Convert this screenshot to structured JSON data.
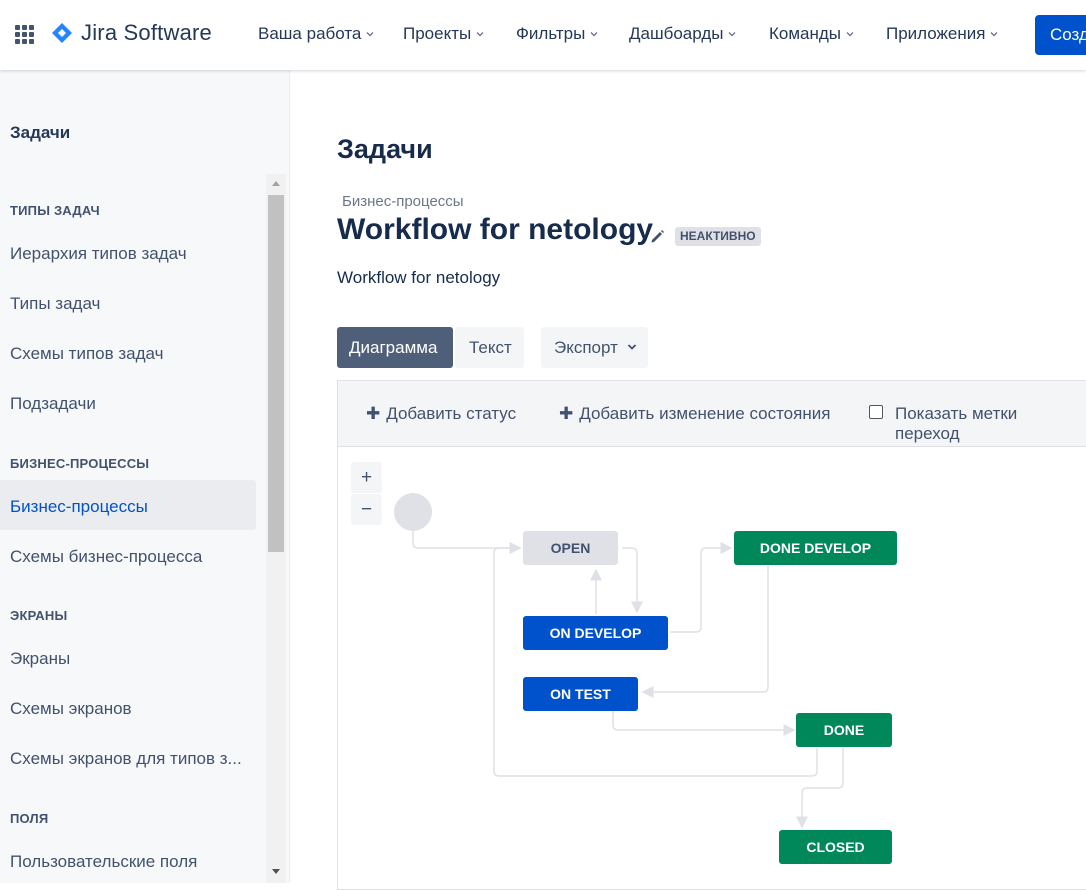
{
  "topbar": {
    "brand": "Jira Software",
    "nav": [
      "Ваша работа",
      "Проекты",
      "Фильтры",
      "Дашбоарды",
      "Команды",
      "Приложения"
    ],
    "create_label": "Созд"
  },
  "sidebar": {
    "title": "Задачи",
    "sections": [
      {
        "heading": "ТИПЫ ЗАДАЧ",
        "items": [
          "Иерархия типов задач",
          "Типы задач",
          "Схемы типов задач",
          "Подзадачи"
        ]
      },
      {
        "heading": "БИЗНЕС-ПРОЦЕССЫ",
        "items": [
          "Бизнес-процессы",
          "Схемы бизнес-процесса"
        ]
      },
      {
        "heading": "ЭКРАНЫ",
        "items": [
          "Экраны",
          "Схемы экранов",
          "Схемы экранов для типов з..."
        ]
      },
      {
        "heading": "ПОЛЯ",
        "items": [
          "Пользовательские поля"
        ]
      }
    ],
    "active_item": "Бизнес-процессы"
  },
  "main": {
    "page_title": "Задачи",
    "breadcrumb": "Бизнес-процессы",
    "workflow_name": "Workflow for netology",
    "status_badge": "НЕАКТИВНО",
    "description": "Workflow for netology",
    "tabs": {
      "diagram": "Диаграмма",
      "text": "Текст",
      "export": "Экспорт"
    },
    "toolbar": {
      "add_status": "Добавить статус",
      "add_transition": "Добавить изменение состояния",
      "show_labels": "Показать метки переход"
    },
    "zoom": {
      "in": "+",
      "out": "−"
    }
  },
  "diagram": {
    "statuses": {
      "open": "OPEN",
      "done_develop": "DONE DEVELOP",
      "on_develop": "ON DEVELOP",
      "on_test": "ON TEST",
      "done": "DONE",
      "closed": "CLOSED"
    }
  },
  "colors": {
    "primary": "#0052cc",
    "success": "#00875a",
    "neutral": "#dfe1e6",
    "sidebar_bg": "#f7f8fa"
  }
}
